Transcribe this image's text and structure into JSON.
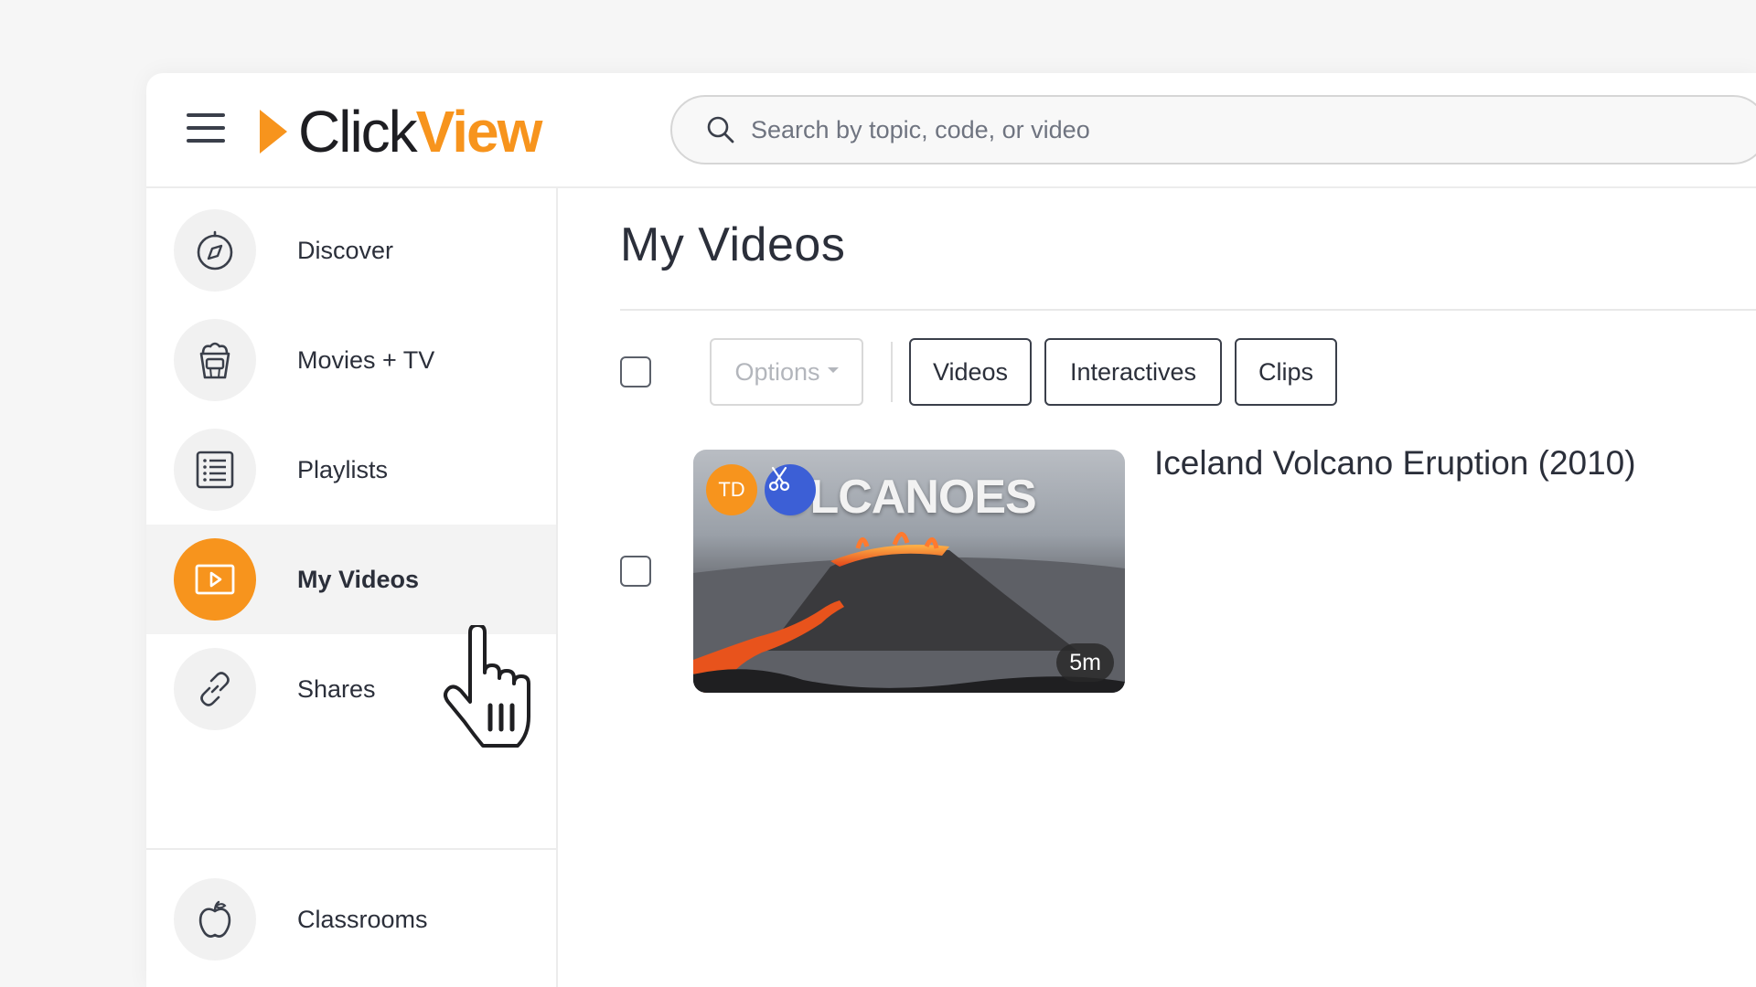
{
  "header": {
    "logo": {
      "part1": "Click",
      "part2": "View"
    },
    "search": {
      "placeholder": "Search by topic, code, or video"
    }
  },
  "sidebar": {
    "items": [
      {
        "label": "Discover",
        "icon": "compass-icon",
        "active": false
      },
      {
        "label": "Movies + TV",
        "icon": "popcorn-icon",
        "active": false
      },
      {
        "label": "Playlists",
        "icon": "list-icon",
        "active": false
      },
      {
        "label": "My Videos",
        "icon": "play-icon",
        "active": true
      },
      {
        "label": "Shares",
        "icon": "link-icon",
        "active": false
      },
      {
        "label": "Classrooms",
        "icon": "apple-icon",
        "active": false
      }
    ]
  },
  "main": {
    "title": "My Videos",
    "toolbar": {
      "options_label": "Options",
      "filters": [
        "Videos",
        "Interactives",
        "Clips"
      ]
    },
    "videos": [
      {
        "title": "Iceland Volcano Eruption (2010)",
        "thumbnail_text": "OLCANOES",
        "owner_initials": "TD",
        "duration": "5m",
        "is_clip": true
      }
    ]
  },
  "colors": {
    "accent": "#f7941d",
    "clip_badge": "#3c5fd6",
    "text": "#2b2f3a"
  }
}
